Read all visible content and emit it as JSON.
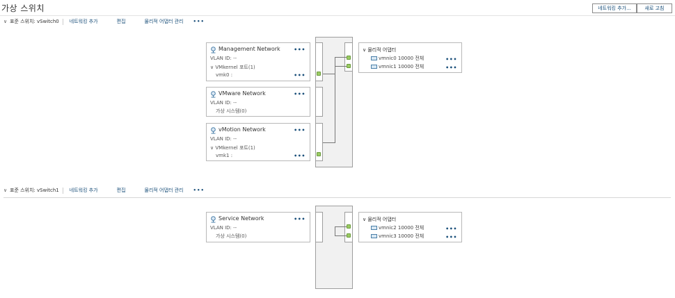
{
  "page": {
    "title": "가상 스위치",
    "add_networking_label": "네트워킹 추가...",
    "refresh_label": "새로 고침"
  },
  "switch0": {
    "label": "표준 스위치: vSwitch0",
    "add_networking": "네트워킹 추가",
    "edit": "편집",
    "manage_adapters": "물리적 어댑터 관리",
    "more": "•••",
    "portgroups": [
      {
        "name": "Management Network",
        "vlan": "VLAN ID: --",
        "vmkernel": "VMkernel 포트(1)",
        "vmk": "vmk0 :"
      },
      {
        "name": "VMware Network",
        "vlan": "VLAN ID: --",
        "vms": "가상 시스템(0)"
      },
      {
        "name": "vMotion Network",
        "vlan": "VLAN ID: --",
        "vmkernel": "VMkernel 포트(1)",
        "vmk": "vmk1 :"
      }
    ],
    "adapters": {
      "header": "물리적 어댑터",
      "nics": [
        {
          "text": "vmnic0 10000 전체"
        },
        {
          "text": "vmnic1 10000 전체"
        }
      ]
    }
  },
  "switch1": {
    "label": "표준 스위치: vSwitch1",
    "add_networking": "네트워킹 추가",
    "edit": "편집",
    "manage_adapters": "물리적 어댑터 관리",
    "more": "•••",
    "portgroups": [
      {
        "name": "Service Network",
        "vlan": "VLAN ID: --",
        "vms": "가상 시스템(0)"
      }
    ],
    "adapters": {
      "header": "물리적 어댑터",
      "nics": [
        {
          "text": "vmnic2 10000 전체"
        },
        {
          "text": "vmnic3 10000 전체"
        }
      ]
    }
  },
  "icons": {
    "portgroup": "network-portgroup-icon",
    "nic": "physical-nic-icon",
    "chevron": "chevron-down-icon"
  },
  "colors": {
    "link": "#1a4f7a",
    "port_active": "#9ccc65",
    "bus_fill": "#f1f1f1"
  }
}
